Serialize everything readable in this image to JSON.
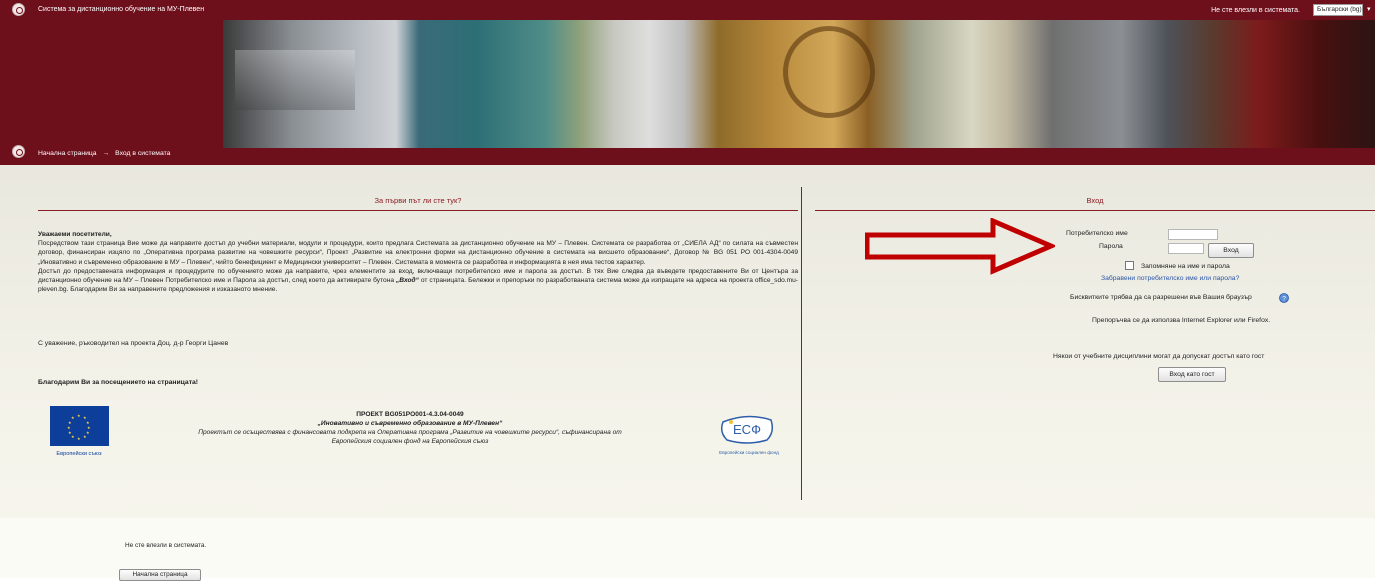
{
  "header": {
    "site_title": "Система за дистанционно обучение на МУ-Плевен",
    "login_status": "Не сте влезли в системата.",
    "language": "Български (bg)"
  },
  "breadcrumb": {
    "home": "Начална страница",
    "separator": "→",
    "current": "Вход в системата"
  },
  "left_panel": {
    "heading": "За първи път ли сте тук?",
    "greeting": "Уважаеми посетители,",
    "paragraph1": "Посредством тази страница Вие може да направите достъп до учебни материали, модули и процедури, които предлага Системата за дистанционно обучение на МУ – Плевен. Системата се разработва от „СИЕЛА АД“ по силата на съвместен договор, финансиран изцяло по „Оперативна програма развитие на човешките ресурси“, Проект „Развитие на електронни форми на дистанционно обучение в системата на висшето образование“, Договор № BG 051 PO 001-4304-0049 „Иновативно и съвременно образование в МУ – Плевен“, чийто бенефициент е Медицински университет – Плевен. Системата в момента се разработва и информацията в нея има тестов характер.",
    "paragraph2_start": "Достъп до предоставената информация и процедурите по обучението може да направите, чрез елементите за вход, включващи потребителско име и парола за достъп. В тях Вие следва да въведете предоставените Ви от Центъра за дистанционно обучение на МУ – Плевен Потребителско име и Парола за достъп, след което да активирате бутона ",
    "paragraph2_button": "„Вход“",
    "paragraph2_end": " от страницата. Бележки и препоръки по разработваната система може да изпращате на адреса на проекта office_sdo.mu-pleven.bg. Благодарим Ви за направените предложения и изказаното мнение.",
    "signature": "С уважение, ръководител на проекта Доц. д-р Георги Цанев",
    "thanks": "Благодарим Ви за посещението на страницата!",
    "eu_caption": "Европейски съюз",
    "project_title": "ПРОЕКТ BG051PO001-4.3.04-0049",
    "project_subtitle": "„Иновативно и съвременно образование в МУ-Плевен“",
    "project_desc_line1": "Проектът се осъществява с финансовата подкрепа на Оперативна програма „Развитие на човешките ресурси“, съфинансирана от",
    "project_desc_line2": "Европейския социален фонд на Европейския съюз",
    "esf_logo_text": "ЕСФ",
    "esf_caption": "Европейски социален фонд"
  },
  "login": {
    "heading": "Вход",
    "username_label": "Потребителско име",
    "username_value": "",
    "password_label": "Парола",
    "password_value": "",
    "login_button": "Вход",
    "remember_label": "Запомняне на име и парола",
    "remember_checked": false,
    "forgot_link": "Забравени потребителско име или парола?",
    "cookies_note": "Бисквитките трябва да са разрешени във Вашия браузър",
    "browser_note": "Препоръчва се да използва Internet Explorer или Firefox.",
    "guest_note": "Някои от учебните дисциплини могат да допускат достъп като гост",
    "guest_button": "Вход като гост"
  },
  "footer": {
    "login_status": "Не сте влезли в системата.",
    "home_button": "Начална страница"
  },
  "colors": {
    "brand": "#6e0f1c",
    "heading": "#8b1b24",
    "link": "#2b55a8",
    "annotation_arrow": "#c00000"
  }
}
